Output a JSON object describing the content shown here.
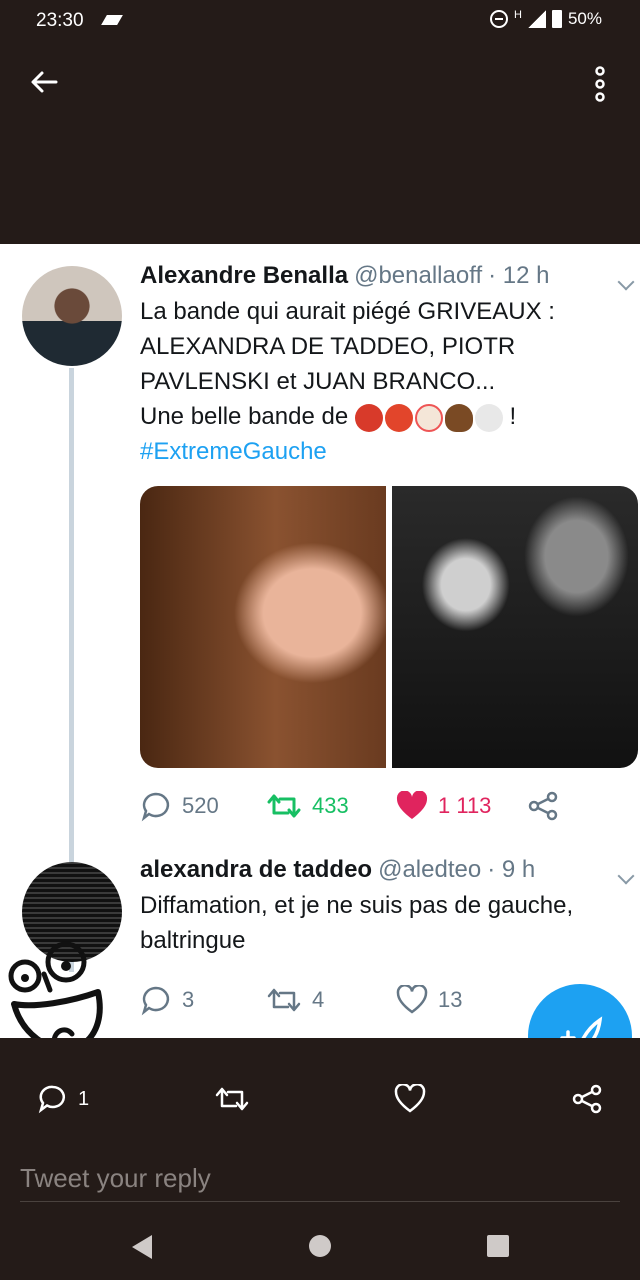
{
  "status_bar": {
    "time": "23:30",
    "network_label": "H",
    "battery": "50%"
  },
  "tweets": [
    {
      "name": "Alexandre Benalla",
      "handle": "@benallaoff",
      "time": "· 12 h",
      "lines": [
        "La bande qui aurait piégé GRIVEAUX :",
        "ALEXANDRA DE TADDEO, PIOTR",
        "PAVLENSKI et JUAN BRANCO...",
        "Une belle bande de"
      ],
      "emoji_names": [
        "cursing-face",
        "angry-face",
        "clown-face",
        "pile-of-poo",
        "skull-and-crossbones"
      ],
      "after_emojis": "!",
      "hashtag": "#ExtremeGauche",
      "replies": "520",
      "retweets": "433",
      "likes": "1 113",
      "colors": {
        "retweet": "#17bf63",
        "like": "#e0245e"
      }
    },
    {
      "name": "alexandra de taddeo",
      "handle": "@aledteo",
      "time": "· 9 h",
      "lines": [
        "Diffamation, et je ne suis pas de gauche,",
        "baltringue"
      ],
      "replies": "3",
      "retweets": "4",
      "likes": "13"
    }
  ],
  "bottom_bar": {
    "reply_count": "1",
    "reply_placeholder": "Tweet your reply"
  },
  "colors": {
    "accent": "#1da1f2",
    "chrome_background": "#241b18",
    "secondary_text": "#657786"
  }
}
